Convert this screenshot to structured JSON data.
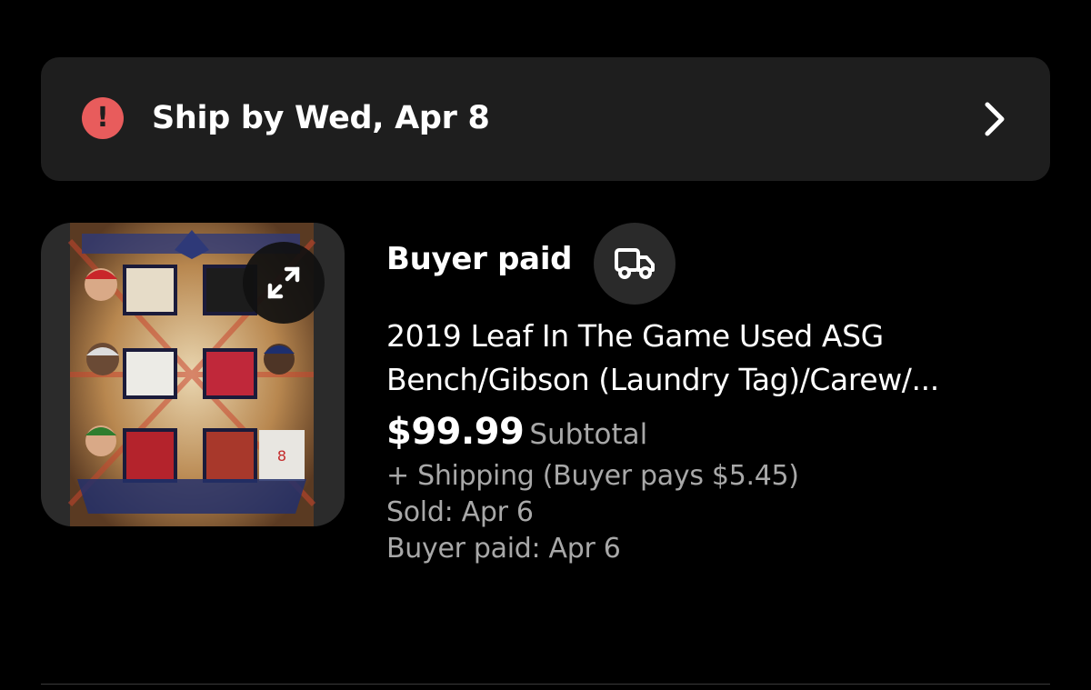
{
  "ship_banner": {
    "icon": "alert-circle-icon",
    "text": "Ship by Wed, Apr 8",
    "chevron_icon": "chevron-right-icon"
  },
  "item": {
    "image": {
      "description_icon": "trading-card-image",
      "expand_icon": "expand-icon"
    },
    "status": "Buyer paid",
    "truck_icon": "truck-icon",
    "title_line1": "2019 Leaf In The Game Used ASG",
    "title_line2": "Bench/Gibson (Laundry Tag)/Carew/...",
    "price": "$99.99",
    "price_label": "Subtotal",
    "shipping": "+ Shipping (Buyer pays $5.45)",
    "sold": "Sold: Apr 6",
    "buyer_paid": "Buyer paid: Apr 6"
  },
  "colors": {
    "background": "#000000",
    "banner": "#1e1e1e",
    "alert": "#e85c5c",
    "secondary_text": "#a8a8a8"
  }
}
